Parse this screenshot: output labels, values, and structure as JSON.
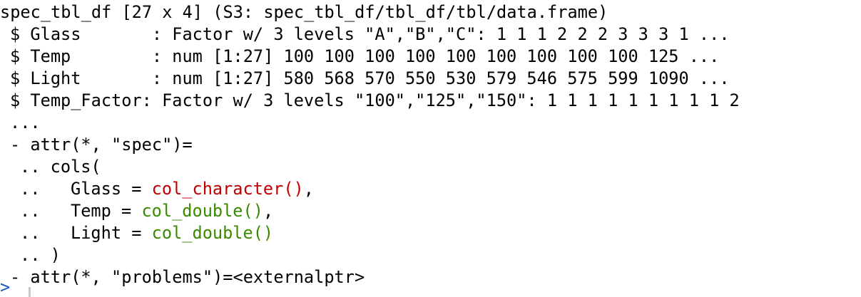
{
  "console": {
    "header": "spec_tbl_df [27 x 4] (S3: spec_tbl_df/tbl_df/tbl/data.frame)",
    "columns": [
      "$ Glass       : Factor w/ 3 levels \"A\",\"B\",\"C\": 1 1 1 2 2 2 3 3 3 1 ...",
      "$ Temp        : num [1:27] 100 100 100 100 100 100 100 100 100 125 ...",
      "$ Light       : num [1:27] 580 568 570 550 530 579 546 575 599 1090 ...",
      "$ Temp_Factor: Factor w/ 3 levels \"100\",\"125\",\"150\": 1 1 1 1 1 1 1 1 1 2"
    ],
    "ellipsis": "...",
    "attr_spec": "- attr(*, \"spec\")=",
    "cols_open": ".. cols(",
    "spec_lines": [
      {
        "prefix": "..   Glass = ",
        "call": "col_character()",
        "suffix": ",",
        "color": "#c00000"
      },
      {
        "prefix": "..   Temp = ",
        "call": "col_double()",
        "suffix": ",",
        "color": "#3a8a00"
      },
      {
        "prefix": "..   Light = ",
        "call": "col_double()",
        "suffix": "",
        "color": "#3a8a00"
      }
    ],
    "cols_close": ".. )",
    "attr_problems": "- attr(*, \"problems\")=<externalptr>",
    "prompt": ">"
  }
}
